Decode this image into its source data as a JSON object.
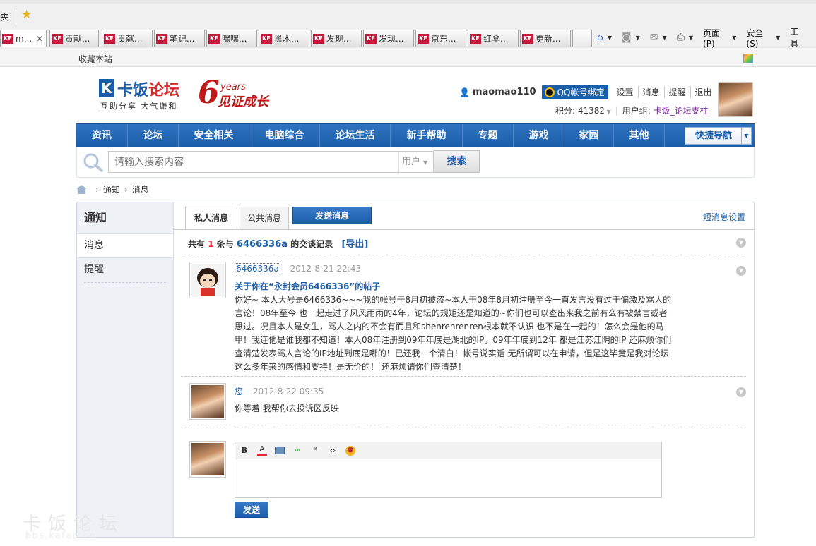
{
  "browser": {
    "fav_label": "夹",
    "tabs": [
      {
        "label": "m...",
        "active": true
      },
      {
        "label": "贡献..."
      },
      {
        "label": "贡献..."
      },
      {
        "label": "笔记..."
      },
      {
        "label": "嘿嘿..."
      },
      {
        "label": "黑木..."
      },
      {
        "label": "发现..."
      },
      {
        "label": "发现..."
      },
      {
        "label": "京东..."
      },
      {
        "label": "红伞..."
      },
      {
        "label": "更新..."
      }
    ],
    "tab_icon_text": "KF",
    "commands": {
      "page": "页面(P)",
      "safety": "安全(S)",
      "tools": "工具"
    }
  },
  "site": {
    "fav_site": "收藏本站",
    "logo": {
      "k": "K",
      "name_a": "卡饭",
      "name_b": "论坛",
      "slogan": "互助分享  大气谦和",
      "six": "6",
      "years": "years",
      "grow": "见证成长"
    },
    "user": {
      "name": "maomao110",
      "qq_bind": "QQ帐号绑定",
      "links": [
        "设置",
        "消息",
        "提醒",
        "退出"
      ],
      "score": "积分: 41382",
      "group_label": "用户组:",
      "group": "卡饭_论坛支柱"
    }
  },
  "nav": {
    "items": [
      "资讯",
      "论坛",
      "安全相关",
      "电脑综合",
      "论坛生活",
      "新手帮助",
      "专题",
      "游戏",
      "家园",
      "其他"
    ],
    "quick": "快捷导航"
  },
  "search": {
    "placeholder": "请输入搜索内容",
    "type": "用户",
    "button": "搜索"
  },
  "breadcrumb": [
    "通知",
    "消息"
  ],
  "sidebar": {
    "title": "通知",
    "items": [
      "消息",
      "提醒"
    ]
  },
  "tabs": {
    "private": "私人消息",
    "public": "公共消息",
    "send": "发送消息",
    "settings": "短消息设置"
  },
  "summary": {
    "prefix": "共有",
    "count": "1",
    "mid": "条与",
    "user": "6466336a",
    "suffix": "的交谈记录",
    "export": "[导出]"
  },
  "messages": [
    {
      "author": "6466336a",
      "time": "2012-8-21 22:43",
      "title": "关于你在“永封会员6466336”的帖子",
      "body": "你好~ 本人大号是6466336~~~我的帐号于8月初被盗~本人于08年8月初注册至今一直发言没有过于偏激及骂人的言论！08年至今 也一起走过了风风雨雨的4年，论坛的规矩还是知道的~你们也可以查出来我之前有么有被禁言或者思过。况且本人是女生，骂人之内的不会有而且和shenrenrenren根本就不认识 也不是在一起的！怎么会是他的马甲！我连他是谁我都不知道！本人08年注册到09年年底是湖北的IP。09年年底到12年 都是江苏江阴的IP 还麻烦你们查清楚发表骂人言论的IP地址到底是哪的！已还我一个清白！帐号说实话 无所谓可以在申请，但是这毕竟是我对论坛这么多年来的感情和支持！是无价的！ 还麻烦请你们查清楚！"
    },
    {
      "author": "您",
      "time": "2012-8-22 09:35",
      "body": "你等着 我帮你去投诉区反映"
    }
  ],
  "editor": {
    "submit": "发送"
  },
  "watermark": {
    "main": "卡饭论坛",
    "sub": "bbs.kafan.cn"
  }
}
